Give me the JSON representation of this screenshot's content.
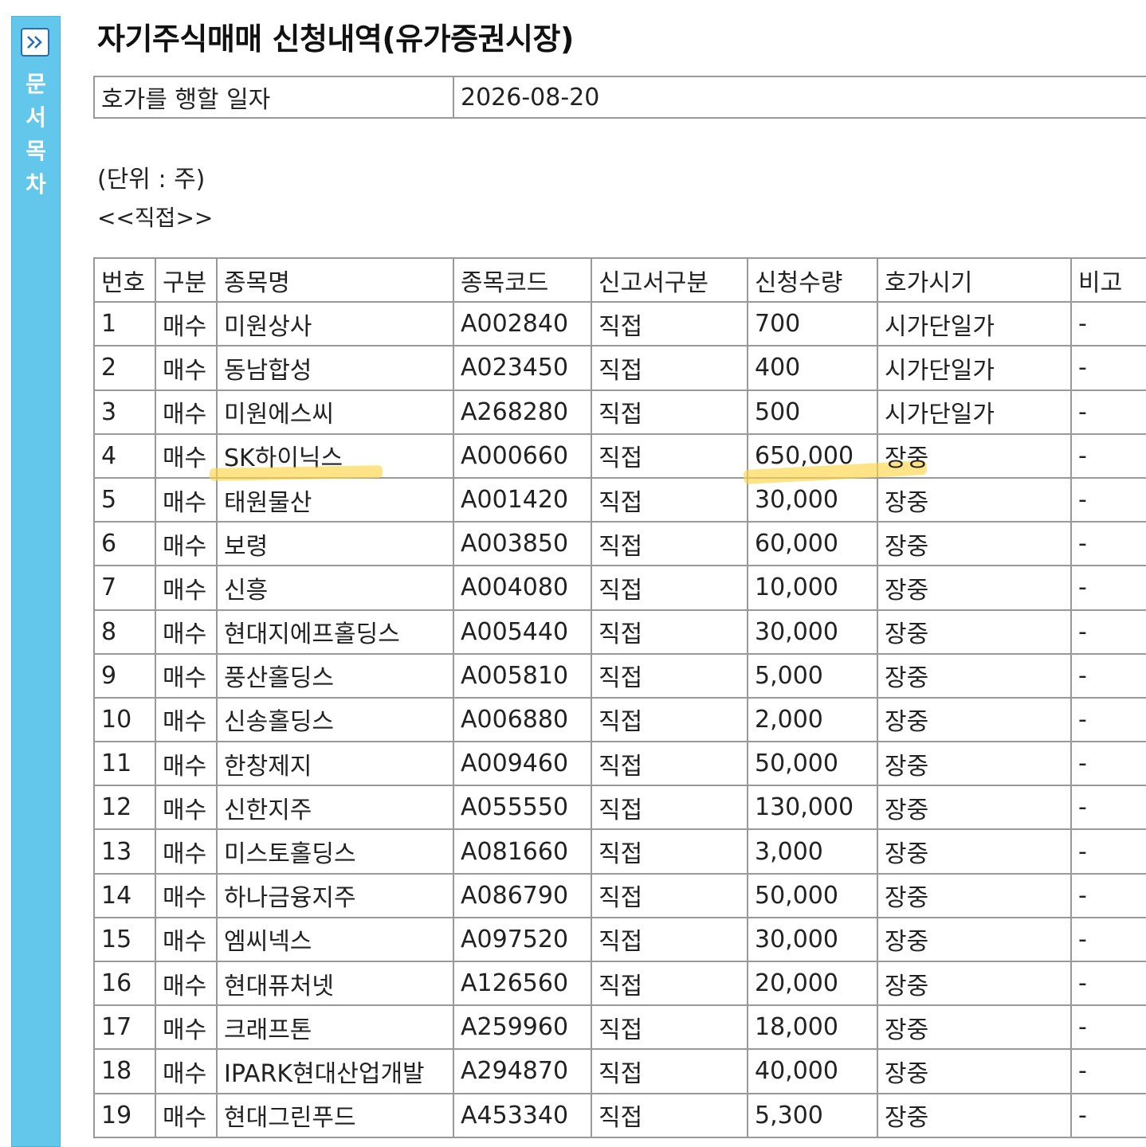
{
  "toc": {
    "toggle_icon": "double-chevron-right-icon",
    "label_chars": [
      "문",
      "서",
      "목",
      "차"
    ]
  },
  "title": "자기주식매매 신청내역(유가증권시장)",
  "info": {
    "label": "호가를 행할 일자",
    "value": "2026-08-20"
  },
  "unit": "(단위 : 주)",
  "section": "<<직접>>",
  "columns": [
    "번호",
    "구분",
    "종목명",
    "종목코드",
    "신고서구분",
    "신청수량",
    "호가시기",
    "비고"
  ],
  "rows": [
    {
      "no": "1",
      "type": "매수",
      "name": "미원상사",
      "code": "A002840",
      "report": "직접",
      "qty": "700",
      "timing": "시가단일가",
      "note": "-"
    },
    {
      "no": "2",
      "type": "매수",
      "name": "동남합성",
      "code": "A023450",
      "report": "직접",
      "qty": "400",
      "timing": "시가단일가",
      "note": "-"
    },
    {
      "no": "3",
      "type": "매수",
      "name": "미원에스씨",
      "code": "A268280",
      "report": "직접",
      "qty": "500",
      "timing": "시가단일가",
      "note": "-"
    },
    {
      "no": "4",
      "type": "매수",
      "name": "SK하이닉스",
      "code": "A000660",
      "report": "직접",
      "qty": "650,000",
      "timing": "장중",
      "note": "-"
    },
    {
      "no": "5",
      "type": "매수",
      "name": "태원물산",
      "code": "A001420",
      "report": "직접",
      "qty": "30,000",
      "timing": "장중",
      "note": "-"
    },
    {
      "no": "6",
      "type": "매수",
      "name": "보령",
      "code": "A003850",
      "report": "직접",
      "qty": "60,000",
      "timing": "장중",
      "note": "-"
    },
    {
      "no": "7",
      "type": "매수",
      "name": "신흥",
      "code": "A004080",
      "report": "직접",
      "qty": "10,000",
      "timing": "장중",
      "note": "-"
    },
    {
      "no": "8",
      "type": "매수",
      "name": "현대지에프홀딩스",
      "code": "A005440",
      "report": "직접",
      "qty": "30,000",
      "timing": "장중",
      "note": "-"
    },
    {
      "no": "9",
      "type": "매수",
      "name": "풍산홀딩스",
      "code": "A005810",
      "report": "직접",
      "qty": "5,000",
      "timing": "장중",
      "note": "-"
    },
    {
      "no": "10",
      "type": "매수",
      "name": "신송홀딩스",
      "code": "A006880",
      "report": "직접",
      "qty": "2,000",
      "timing": "장중",
      "note": "-"
    },
    {
      "no": "11",
      "type": "매수",
      "name": "한창제지",
      "code": "A009460",
      "report": "직접",
      "qty": "50,000",
      "timing": "장중",
      "note": "-"
    },
    {
      "no": "12",
      "type": "매수",
      "name": "신한지주",
      "code": "A055550",
      "report": "직접",
      "qty": "130,000",
      "timing": "장중",
      "note": "-"
    },
    {
      "no": "13",
      "type": "매수",
      "name": "미스토홀딩스",
      "code": "A081660",
      "report": "직접",
      "qty": "3,000",
      "timing": "장중",
      "note": "-"
    },
    {
      "no": "14",
      "type": "매수",
      "name": "하나금융지주",
      "code": "A086790",
      "report": "직접",
      "qty": "50,000",
      "timing": "장중",
      "note": "-"
    },
    {
      "no": "15",
      "type": "매수",
      "name": "엠씨넥스",
      "code": "A097520",
      "report": "직접",
      "qty": "30,000",
      "timing": "장중",
      "note": "-"
    },
    {
      "no": "16",
      "type": "매수",
      "name": "현대퓨처넷",
      "code": "A126560",
      "report": "직접",
      "qty": "20,000",
      "timing": "장중",
      "note": "-"
    },
    {
      "no": "17",
      "type": "매수",
      "name": "크래프톤",
      "code": "A259960",
      "report": "직접",
      "qty": "18,000",
      "timing": "장중",
      "note": "-"
    },
    {
      "no": "18",
      "type": "매수",
      "name": "IPARK현대산업개발",
      "code": "A294870",
      "report": "직접",
      "qty": "40,000",
      "timing": "장중",
      "note": "-"
    },
    {
      "no": "19",
      "type": "매수",
      "name": "현대그린푸드",
      "code": "A453340",
      "report": "직접",
      "qty": "5,300",
      "timing": "장중",
      "note": "-"
    }
  ],
  "highlight_color": "#ffd646"
}
